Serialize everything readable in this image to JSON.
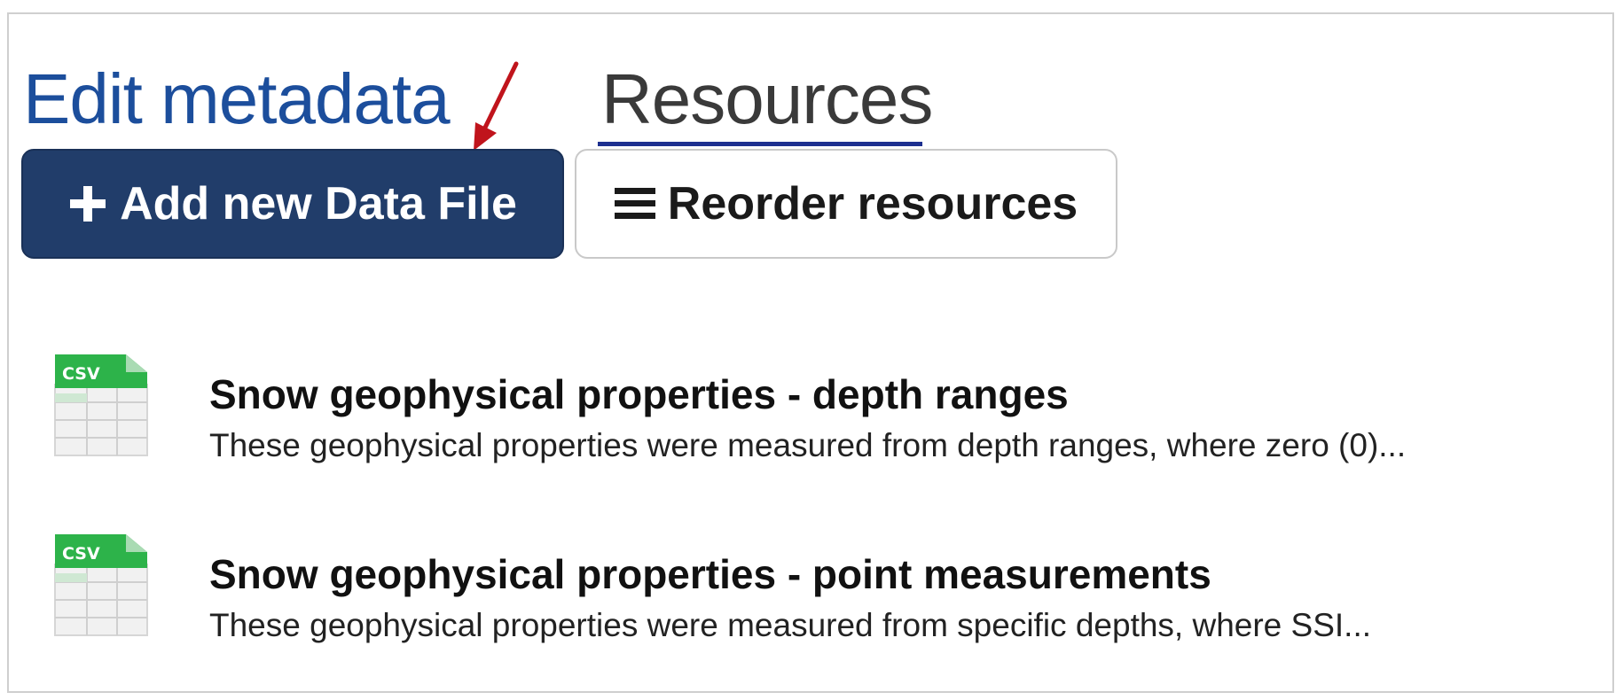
{
  "tabs": {
    "edit_metadata": "Edit metadata",
    "resources": "Resources"
  },
  "buttons": {
    "add_new": "Add new Data File",
    "reorder": "Reorder resources"
  },
  "resources": [
    {
      "format": "csv",
      "title": "Snow geophysical properties - depth ranges",
      "description": "These geophysical properties were measured from depth ranges, where zero (0)..."
    },
    {
      "format": "csv",
      "title": "Snow geophysical properties - point measurements",
      "description": "These geophysical properties were measured from specific depths, where SSI..."
    }
  ],
  "icons": {
    "add": "plus-icon",
    "reorder": "list-icon",
    "file": "csv-file-icon",
    "annotation": "red-arrow-annotation"
  },
  "colors": {
    "link_blue": "#1c4e9c",
    "primary_button": "#213d6a",
    "tab_underline": "#1c2f8f",
    "csv_green": "#2db34a",
    "annotation_red": "#c0141c"
  }
}
